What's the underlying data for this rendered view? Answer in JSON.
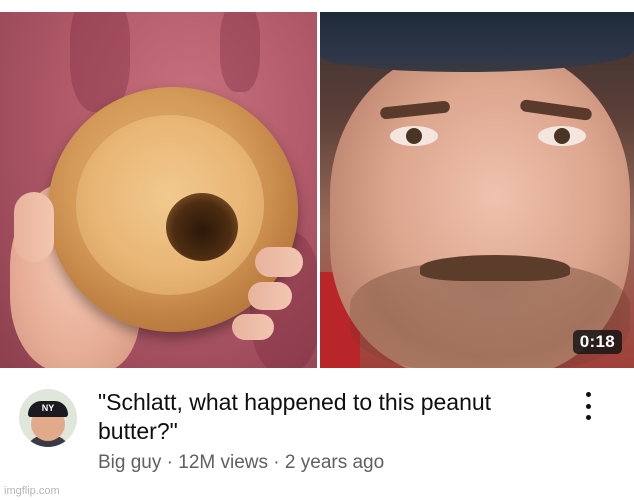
{
  "video": {
    "duration": "0:18",
    "title": "\"Schlatt, what happened to this peanut butter?\"",
    "channel": "Big guy",
    "views": "12M views",
    "separator": "·",
    "age": "2 years ago"
  },
  "avatar": {
    "cap_logo": "NY"
  },
  "icons": {
    "more": "more-vert-icon"
  },
  "watermark": "imgflip.com"
}
